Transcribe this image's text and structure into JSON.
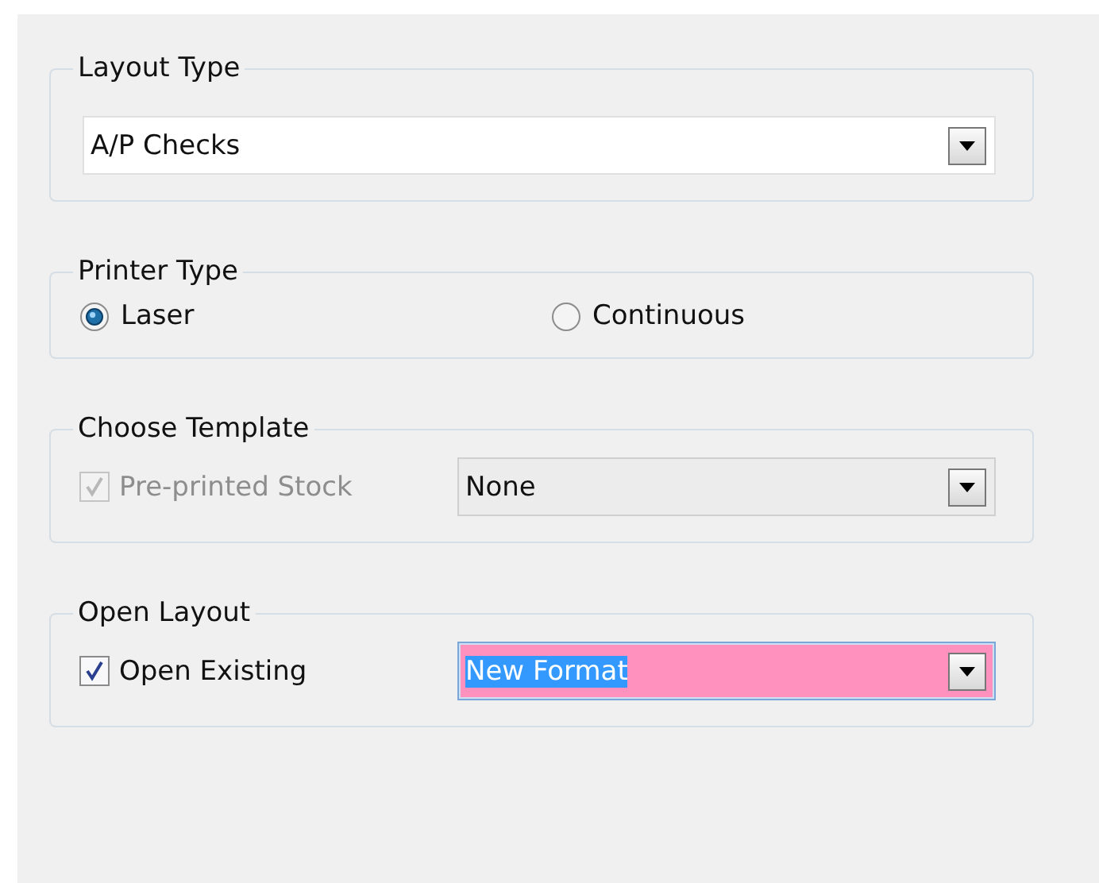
{
  "groups": [
    {
      "title": "Layout Type",
      "controls": [
        {
          "kind": "combo",
          "value": "A/P Checks",
          "readonly": false,
          "invalid": false,
          "text_selected": false
        }
      ]
    },
    {
      "title": "Printer Type",
      "controls": [
        {
          "kind": "radio",
          "label": "Laser",
          "selected": true
        },
        {
          "kind": "radio",
          "label": "Continuous",
          "selected": false
        }
      ]
    },
    {
      "title": "Choose Template",
      "controls": [
        {
          "kind": "check",
          "label": "Pre-printed Stock",
          "checked": true,
          "disabled": true
        },
        {
          "kind": "combo",
          "value": "None",
          "readonly": true,
          "invalid": false,
          "text_selected": false
        }
      ]
    },
    {
      "title": "Open Layout",
      "controls": [
        {
          "kind": "check",
          "label": "Open Existing",
          "checked": true,
          "disabled": false
        },
        {
          "kind": "combo",
          "value": "New Format",
          "readonly": false,
          "invalid": true,
          "text_selected": true
        }
      ]
    }
  ]
}
